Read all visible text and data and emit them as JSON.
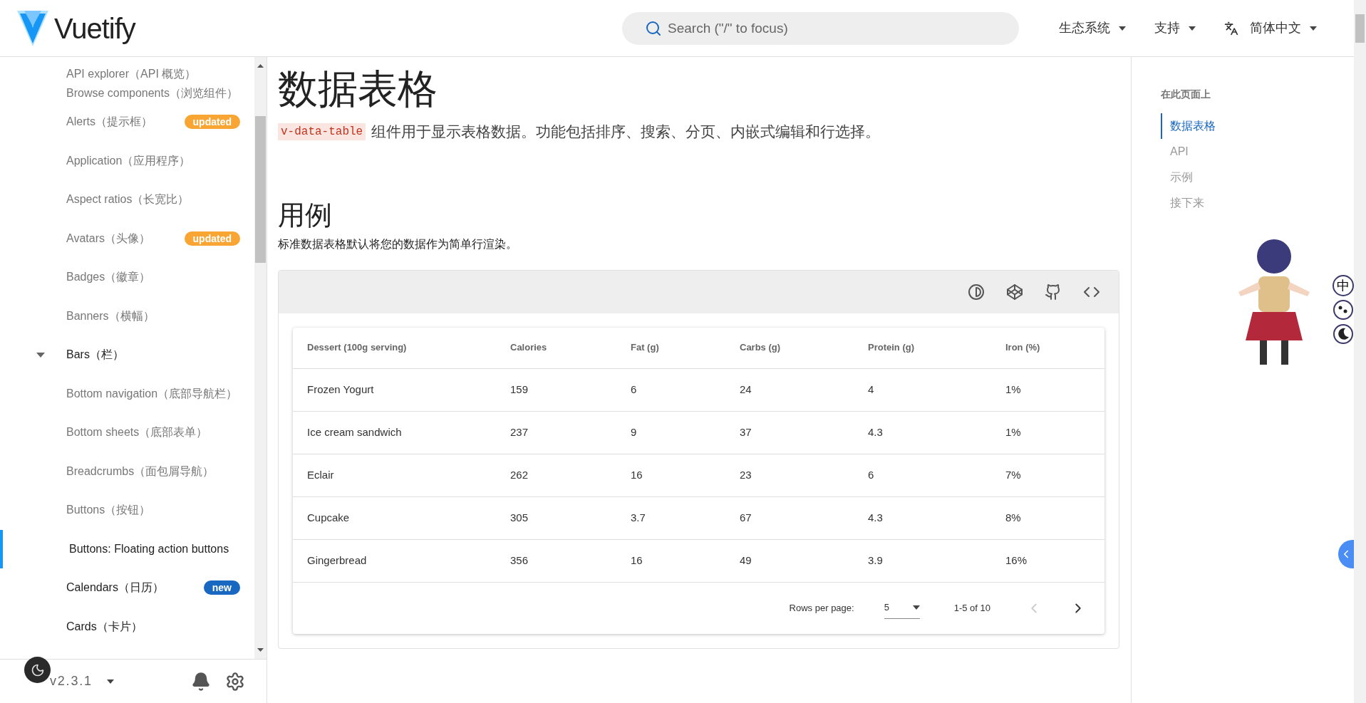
{
  "header": {
    "brand": "Vuetify",
    "search": {
      "placeholder": "Search (\"/\" to focus)"
    },
    "menus": [
      {
        "label": "生态系统",
        "kind": "plain"
      },
      {
        "label": "支持",
        "kind": "plain"
      },
      {
        "label": "简体中文",
        "kind": "language"
      }
    ]
  },
  "sidebar": {
    "items": [
      {
        "label": "API explorer（API 概览）",
        "kind": "link",
        "muted": true,
        "selected": false,
        "compact": true
      },
      {
        "label": "Browse components（浏览组件）",
        "kind": "link",
        "muted": true,
        "selected": false,
        "compact": true
      },
      {
        "label": "Alerts（提示框）",
        "kind": "link",
        "muted": true,
        "selected": false,
        "badge": {
          "text": "updated",
          "color": "#f9a533"
        }
      },
      {
        "label": "Application（应用程序）",
        "kind": "link",
        "muted": true,
        "selected": false
      },
      {
        "label": "Aspect ratios（长宽比）",
        "kind": "link",
        "muted": true,
        "selected": false
      },
      {
        "label": "Avatars（头像）",
        "kind": "link",
        "muted": true,
        "selected": false,
        "badge": {
          "text": "updated",
          "color": "#f9a533"
        }
      },
      {
        "label": "Badges（徽章）",
        "kind": "link",
        "muted": true,
        "selected": false
      },
      {
        "label": "Banners（横幅）",
        "kind": "link",
        "muted": true,
        "selected": false
      },
      {
        "label": "Bars（栏）",
        "kind": "group",
        "muted": false,
        "selected": false,
        "expanded": true
      },
      {
        "label": "Bottom navigation（底部导航栏）",
        "kind": "link",
        "muted": true,
        "selected": false
      },
      {
        "label": "Bottom sheets（底部表单）",
        "kind": "link",
        "muted": true,
        "selected": false
      },
      {
        "label": "Breadcrumbs（面包屑导航）",
        "kind": "link",
        "muted": true,
        "selected": false
      },
      {
        "label": "Buttons（按钮）",
        "kind": "link",
        "muted": true,
        "selected": false
      },
      {
        "label": "Buttons: Floating action buttons",
        "kind": "link",
        "muted": false,
        "selected": true
      },
      {
        "label": "Calendars（日历）",
        "kind": "link",
        "muted": false,
        "selected": false,
        "badge": {
          "text": "new",
          "color": "#1867c0"
        }
      },
      {
        "label": "Cards（卡片）",
        "kind": "link",
        "muted": false,
        "selected": false
      }
    ],
    "version": "v2.3.1"
  },
  "page": {
    "title": "数据表格",
    "intro_code": "v-data-table",
    "intro": "组件用于显示表格数据。功能包括排序、搜索、分页、内嵌式编辑和行选择。",
    "section_title": "用例",
    "section_text": "标准数据表格默认将您的数据作为简单行渲染。",
    "table": {
      "columns": [
        "Dessert (100g serving)",
        "Calories",
        "Fat (g)",
        "Carbs (g)",
        "Protein (g)",
        "Iron (%)"
      ],
      "rows": [
        [
          "Frozen Yogurt",
          "159",
          "6",
          "24",
          "4",
          "1%"
        ],
        [
          "Ice cream sandwich",
          "237",
          "9",
          "37",
          "4.3",
          "1%"
        ],
        [
          "Eclair",
          "262",
          "16",
          "23",
          "6",
          "7%"
        ],
        [
          "Cupcake",
          "305",
          "3.7",
          "67",
          "4.3",
          "8%"
        ],
        [
          "Gingerbread",
          "356",
          "16",
          "49",
          "3.9",
          "16%"
        ]
      ],
      "rows_per_page_label": "Rows per page:",
      "rows_per_page": "5",
      "range": "1-5 of 10",
      "prev_disabled": true
    }
  },
  "toc": {
    "title": "在此页面上",
    "items": [
      {
        "label": "数据表格",
        "selected": true
      },
      {
        "label": "API",
        "selected": false
      },
      {
        "label": "示例",
        "selected": false
      },
      {
        "label": "接下来",
        "selected": false
      }
    ]
  },
  "widget": {
    "language_button": "中"
  }
}
